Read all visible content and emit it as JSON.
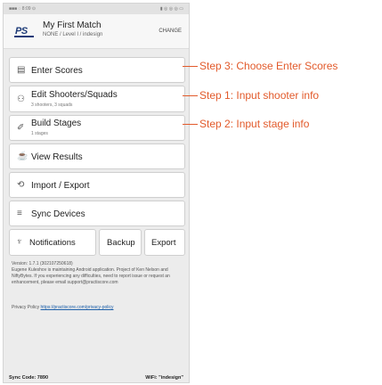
{
  "statusbar": {
    "left": "■■■ ◌ 8:09 ⊙",
    "right": "▮ ◎ ◎ ◎ ▭"
  },
  "header": {
    "logo": "PS",
    "title": "My First Match",
    "subtitle": "NONE / Level I / indesign",
    "change": "CHANGE"
  },
  "menu": [
    {
      "label": "Enter Scores",
      "icon": "▤"
    },
    {
      "label": "Edit Shooters/Squads",
      "sub": "3 shooters, 3 squads",
      "icon": "⚇"
    },
    {
      "label": "Build Stages",
      "sub": "1 stages",
      "icon": "✐"
    },
    {
      "label": "View Results",
      "icon": "☕"
    },
    {
      "label": "Import / Export",
      "icon": "⟲"
    },
    {
      "label": "Sync Devices",
      "icon": "≡"
    }
  ],
  "bottom": {
    "notifications": "Notifications",
    "backup": "Backup",
    "export": "Export",
    "bell": "♆"
  },
  "version": {
    "line1": "Version: 1.7.1 (302107250618)",
    "body": "Eugene Kuleshov is maintaining Android application. Project of Ken Nelson and NiftyBytes. If you experiencing any difficulties, need to report issue or request an enhancement, please email support@practiscore.com"
  },
  "privacy": {
    "label": "Privacy Policy",
    "link": "https://practiscore.com/privacy-policy"
  },
  "footer": {
    "sync": "Sync Code: 7890",
    "wifi": "WiFi: \"indesign\""
  },
  "annotations": {
    "step3": "Step 3: Choose Enter Scores",
    "step1": "Step 1: Input shooter info",
    "step2": "Step 2: Input stage info",
    "color": "#e25a2b"
  }
}
